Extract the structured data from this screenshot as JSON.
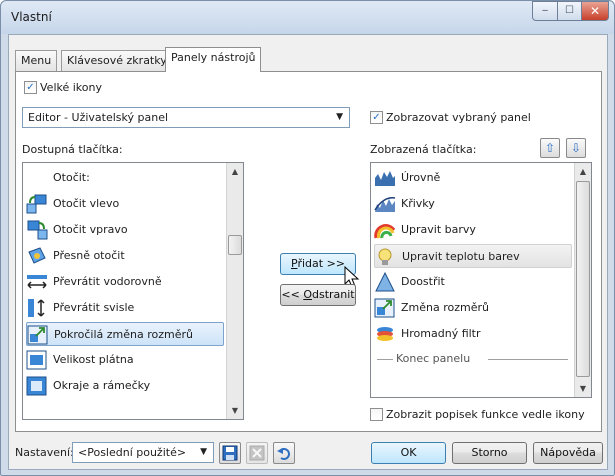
{
  "window": {
    "title": "Vlastní",
    "controls": {
      "minimize": "‒",
      "maximize": "☐",
      "close": "✕"
    }
  },
  "tabs": [
    {
      "label": "Menu",
      "active": false
    },
    {
      "label": "Klávesové zkratky",
      "active": false
    },
    {
      "label": "Panely nástrojů",
      "active": true
    }
  ],
  "options": {
    "large_icons": {
      "label": "Velké ikony",
      "checked": true
    },
    "show_selected_panel": {
      "label": "Zobrazovat vybraný panel",
      "checked": true
    },
    "show_function_labels": {
      "label": "Zobrazit popisek funkce vedle ikony",
      "checked": false
    }
  },
  "panel_select": {
    "value": "Editor - Uživatelský panel",
    "arrow": "▼"
  },
  "available": {
    "label": "Dostupná tlačítka:",
    "items": [
      {
        "label": "Otočit:",
        "icon": "rotate-group-icon"
      },
      {
        "label": "Otočit vlevo",
        "icon": "rotate-left-icon"
      },
      {
        "label": "Otočit vpravo",
        "icon": "rotate-right-icon"
      },
      {
        "label": "Přesně otočit",
        "icon": "rotate-precise-icon"
      },
      {
        "label": "Převrátit vodorovně",
        "icon": "flip-horizontal-icon"
      },
      {
        "label": "Převrátit svisle",
        "icon": "flip-vertical-icon"
      },
      {
        "label": "Pokročilá změna rozměrů",
        "icon": "advanced-resize-icon",
        "selected": true
      },
      {
        "label": "Velikost plátna",
        "icon": "canvas-size-icon"
      },
      {
        "label": "Okraje a rámečky",
        "icon": "borders-frames-icon"
      }
    ]
  },
  "displayed": {
    "label": "Zobrazená tlačítka:",
    "items": [
      {
        "label": "Úrovně",
        "icon": "levels-icon"
      },
      {
        "label": "Křivky",
        "icon": "curves-icon"
      },
      {
        "label": "Upravit barvy",
        "icon": "adjust-colors-icon"
      },
      {
        "label": "Upravit teplotu barev",
        "icon": "color-temperature-icon",
        "hover": true
      },
      {
        "label": "Doostřit",
        "icon": "sharpen-icon"
      },
      {
        "label": "Změna rozměrů",
        "icon": "resize-icon"
      },
      {
        "label": "Hromadný filtr",
        "icon": "batch-filter-icon"
      }
    ],
    "end_label": "Konec panelu"
  },
  "move_buttons": {
    "up": "⇧",
    "down": "⇩"
  },
  "transfer": {
    "add_mnemonic": "P",
    "add_rest": "řidat >>",
    "remove_prefix": "<< ",
    "remove_mnemonic": "O",
    "remove_rest": "dstranit"
  },
  "footer": {
    "settings_label": "Nastavení:",
    "settings_value": "<Poslední použité>",
    "ok": "OK",
    "cancel": "Storno",
    "help": "Nápověda"
  },
  "colors": {
    "accent": "#2a6fc4",
    "selection": "#cde3f8",
    "title_bg": "#cfdbe8"
  }
}
